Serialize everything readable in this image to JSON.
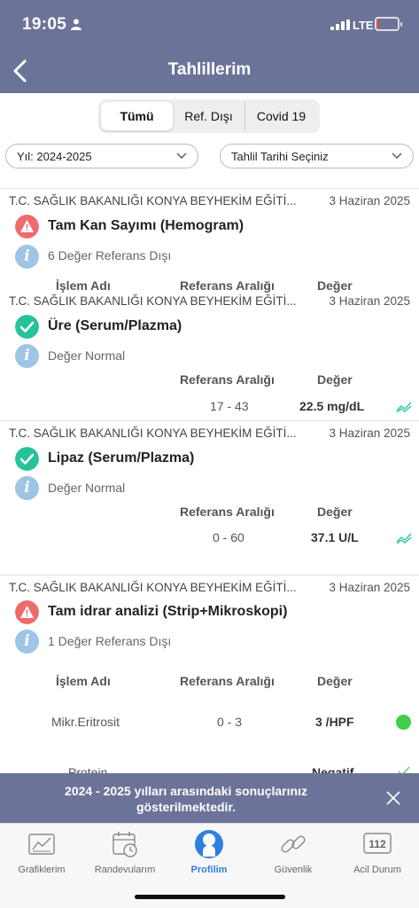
{
  "status": {
    "time": "19:05",
    "network": "LTE",
    "battery_level": 0.1
  },
  "header": {
    "title": "Tahlillerim"
  },
  "segments": [
    {
      "label": "Tümü",
      "active": true
    },
    {
      "label": "Ref. Dışı",
      "active": false
    },
    {
      "label": "Covid 19",
      "active": false
    }
  ],
  "filters": {
    "year": "Yıl: 2024-2025",
    "date": "Tahlil Tarihi Seçiniz"
  },
  "results": [
    {
      "institution": "T.C. SAĞLIK BAKANLIĞI KONYA BEYHEKİM EĞİTİ...",
      "date": "3 Haziran 2025",
      "status": "warning",
      "test": "Tam Kan Sayımı (Hemogram)",
      "info": "6 Değer Referans Dışı",
      "headers": {
        "name": "İşlem Adı",
        "range": "Referans Aralığı",
        "value": "Değer"
      },
      "rows": []
    },
    {
      "institution": "T.C. SAĞLIK BAKANLIĞI KONYA BEYHEKİM EĞİTİ...",
      "date": "3 Haziran 2025",
      "status": "ok",
      "test": "Üre (Serum/Plazma)",
      "info": "Değer Normal",
      "headers": {
        "range": "Referans Aralığı",
        "value": "Değer"
      },
      "rows": [
        {
          "range": "17 - 43",
          "value": "22.5 mg/dL"
        }
      ]
    },
    {
      "institution": "T.C. SAĞLIK BAKANLIĞI KONYA BEYHEKİM EĞİTİ...",
      "date": "3 Haziran 2025",
      "status": "ok",
      "test": "Lipaz (Serum/Plazma)",
      "info": "Değer Normal",
      "headers": {
        "range": "Referans Aralığı",
        "value": "Değer"
      },
      "rows": [
        {
          "range": "0 - 60",
          "value": "37.1 U/L"
        }
      ]
    },
    {
      "institution": "T.C. SAĞLIK BAKANLIĞI KONYA BEYHEKİM EĞİTİ...",
      "date": "3 Haziran 2025",
      "status": "warning",
      "test": "Tam idrar analizi (Strip+Mikroskopi)",
      "info": "1 Değer Referans Dışı",
      "headers": {
        "name": "İşlem Adı",
        "range": "Referans Aralığı",
        "value": "Değer"
      },
      "rows": [
        {
          "name": "Mikr.Eritrosit",
          "range": "0 - 3",
          "value": "3 /HPF",
          "flag": "green-dot"
        },
        {
          "name": "Protein",
          "range": "--",
          "value": "Negatif",
          "flag": "check"
        }
      ]
    }
  ],
  "toast": {
    "message": "2024 - 2025 yılları arasındaki sonuçlarınız gösterilmektedir."
  },
  "tabbar": [
    {
      "label": "Grafiklerim",
      "icon": "chart-icon"
    },
    {
      "label": "Randevularım",
      "icon": "calendar-icon"
    },
    {
      "label": "Profilim",
      "icon": "profile-icon",
      "active": true
    },
    {
      "label": "Güvenlik",
      "icon": "link-icon"
    },
    {
      "label": "Acil Durum",
      "icon": "emergency-112-icon",
      "badge": "112"
    }
  ],
  "colors": {
    "header": "#6b7498",
    "warning": "#ef6b6b",
    "ok": "#27c29a",
    "info": "#9ec4e6",
    "active_tab": "#2f7fe0"
  }
}
